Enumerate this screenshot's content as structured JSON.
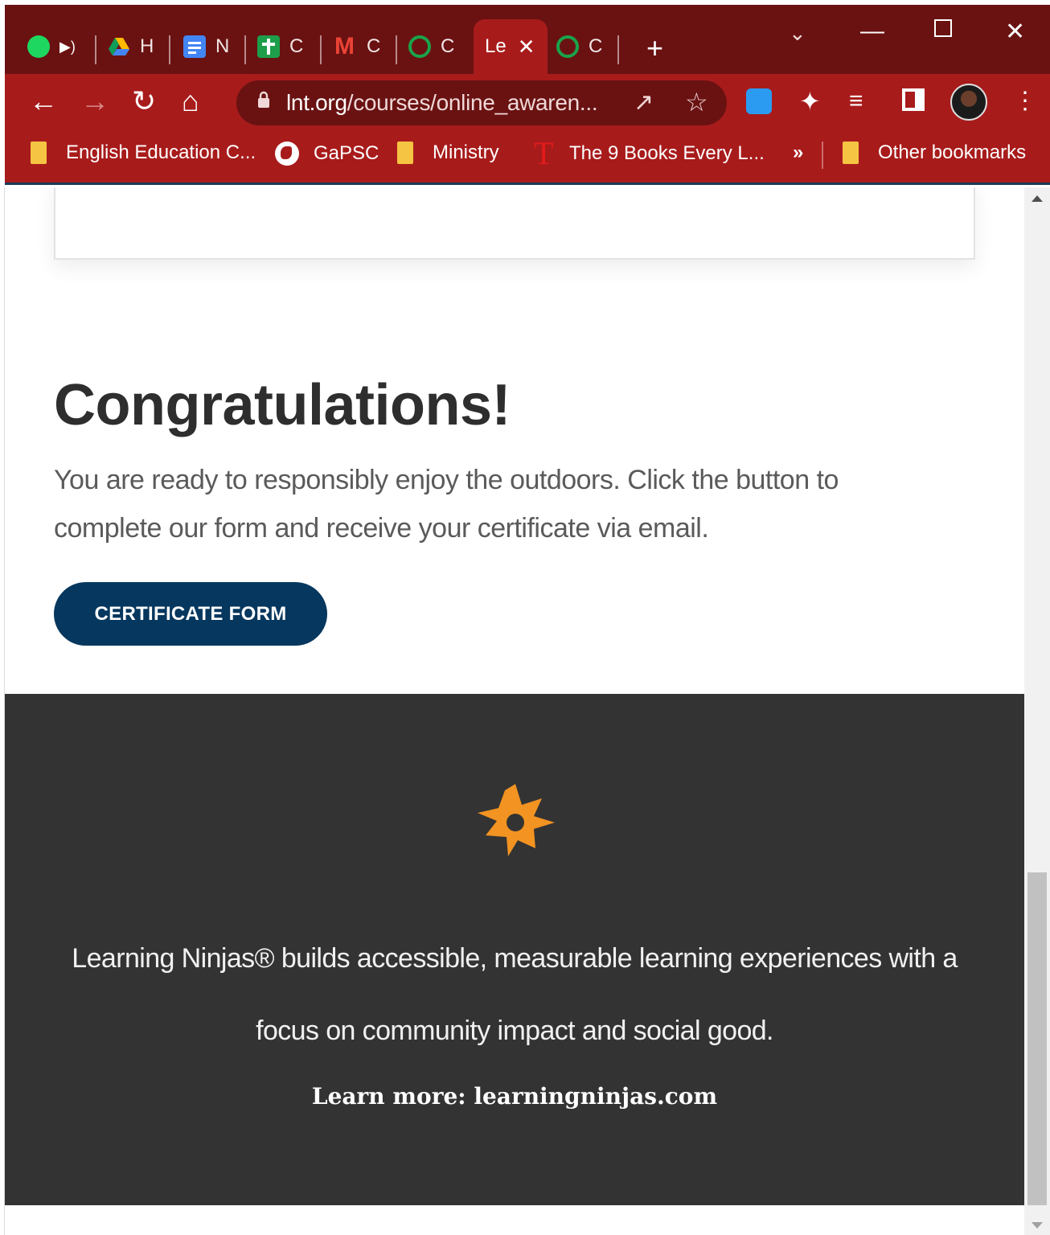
{
  "colors": {
    "tabstrip": "#6a1212",
    "toolbar": "#a81b1b",
    "button_bg": "#06375e",
    "footer_bg": "#333333",
    "logo_orange": "#f29322"
  },
  "browser": {
    "tabs": [
      {
        "icon": "spotify-icon",
        "title": ""
      },
      {
        "icon": "google-drive-icon",
        "title": "H"
      },
      {
        "icon": "google-docs-icon",
        "title": "N"
      },
      {
        "icon": "classroom-icon",
        "title": "C"
      },
      {
        "icon": "gmail-icon",
        "title": "C"
      },
      {
        "icon": "swirl-icon",
        "title": "C"
      },
      {
        "icon": "",
        "title": "Le",
        "active": true
      },
      {
        "icon": "swirl-icon",
        "title": "C"
      }
    ],
    "address_bar": {
      "host": "lnt.org",
      "path": "/courses/online_awaren..."
    },
    "bookmarks": [
      {
        "icon": "folder-icon",
        "label": "English Education C..."
      },
      {
        "icon": "globe-icon",
        "label": "GaPSC"
      },
      {
        "icon": "folder-icon",
        "label": "Ministry"
      },
      {
        "icon": "t-icon",
        "label": "The 9 Books Every L..."
      }
    ],
    "bookmarks_overflow": "»",
    "other_bookmarks": "Other bookmarks"
  },
  "page": {
    "heading": "Congratulations!",
    "lead": "You are ready to responsibly enjoy the outdoors. Click the button to complete our form and receive your certificate via email.",
    "cta_label": "CERTIFICATE FORM",
    "footer": {
      "mission": "Learning Ninjas® builds accessible, measurable learning experiences with a focus on community impact and social good.",
      "learn_more": "Learn more: learningninjas.com"
    }
  }
}
